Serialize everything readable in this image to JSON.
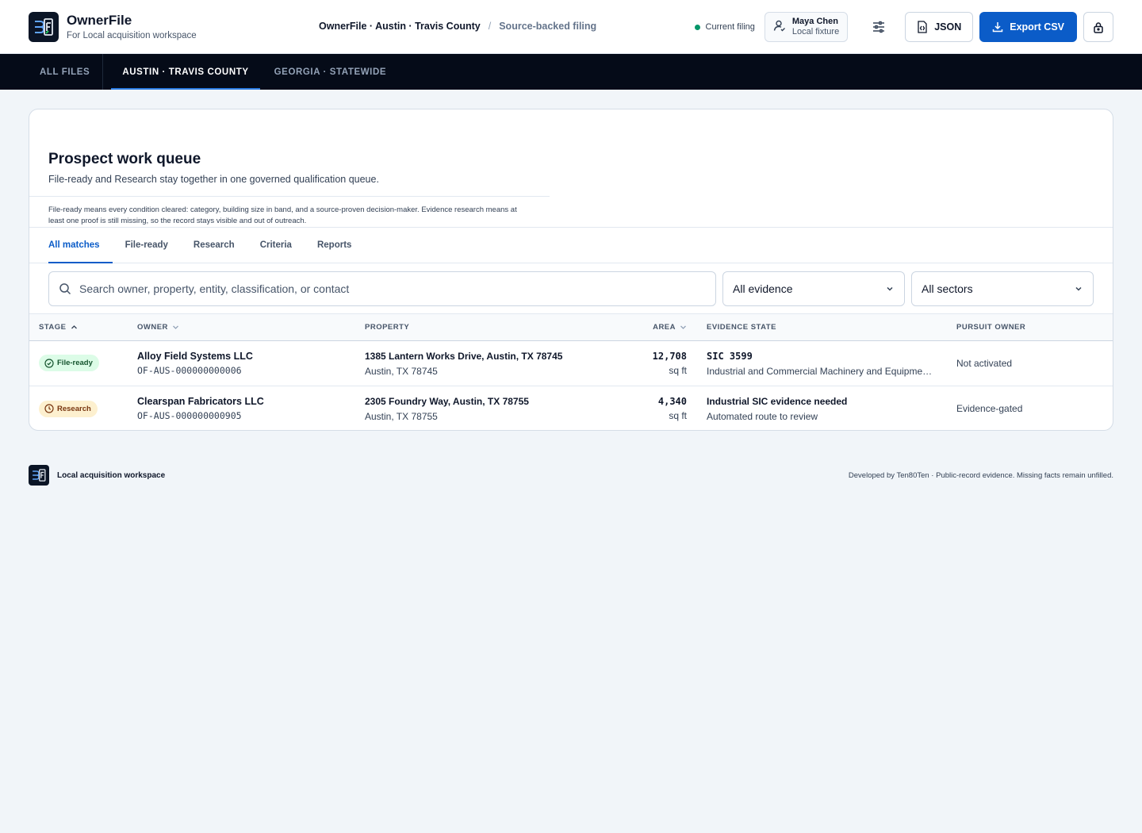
{
  "app": {
    "name": "OwnerFile",
    "subtitle": "For Local acquisition workspace"
  },
  "breadcrumb": {
    "primary": "OwnerFile · Austin · Travis County",
    "separator": "/",
    "secondary": "Source-backed filing"
  },
  "header": {
    "status_label": "Current filing",
    "status_color": "#059669",
    "user_name": "Maya Chen",
    "user_role": "Local fixture",
    "json_label": "JSON",
    "export_label": "Export CSV"
  },
  "nav": {
    "items": [
      "ALL FILES",
      "AUSTIN · TRAVIS COUNTY",
      "GEORGIA · STATEWIDE"
    ],
    "active": "AUSTIN · TRAVIS COUNTY"
  },
  "queue": {
    "title": "Prospect work queue",
    "subtitle": "File-ready and Research stay together in one governed qualification queue.",
    "note": "File-ready means every condition cleared: category, building size in band, and a source-proven decision-maker. Evidence research means at least one proof is still missing, so the record stays visible and out of outreach.",
    "tabs": [
      "All matches",
      "File-ready",
      "Research",
      "Criteria",
      "Reports"
    ],
    "active_tab": "All matches",
    "search_placeholder": "Search owner, property, entity, classification, or contact",
    "evidence_filter": "All evidence",
    "sector_filter": "All sectors"
  },
  "table": {
    "columns": {
      "stage": "STAGE",
      "owner": "OWNER",
      "property": "PROPERTY",
      "area": "AREA",
      "evidence": "EVIDENCE STATE",
      "pursuit": "PURSUIT OWNER"
    },
    "rows": [
      {
        "stage": "File-ready",
        "owner": "Alloy Field Systems LLC",
        "owner_id": "OF-AUS-000000000006",
        "property_line1": "1385 Lantern Works Drive, Austin, TX 78745",
        "property_line2": "Austin, TX 78745",
        "area": "12,708",
        "area_unit": "sq ft",
        "evidence_line1": "SIC 3599",
        "evidence_line2": "Industrial and Commercial Machinery and Equipme…",
        "pursuit": "Not activated"
      },
      {
        "stage": "Research",
        "owner": "Clearspan Fabricators LLC",
        "owner_id": "OF-AUS-000000000905",
        "property_line1": "2305 Foundry Way, Austin, TX 78755",
        "property_line2": "Austin, TX 78755",
        "area": "4,340",
        "area_unit": "sq ft",
        "evidence_line1": "Industrial SIC evidence needed",
        "evidence_line2": "Automated route to review",
        "pursuit": "Evidence-gated"
      }
    ]
  },
  "footer": {
    "left": "Local acquisition workspace",
    "right": "Developed by Ten80Ten · Public-record evidence. Missing facts remain unfilled."
  },
  "colors": {
    "primary": "#0b5cc8",
    "nav_bg": "#050b18",
    "file_ready_bg": "#dcfce7",
    "research_bg": "#fdf0cf"
  }
}
